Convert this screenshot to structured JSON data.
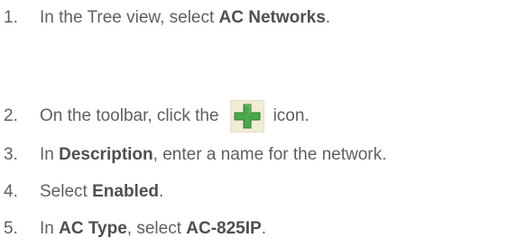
{
  "steps": [
    {
      "number": "1.",
      "pre": "In the Tree view, select ",
      "bold": "AC Networks",
      "post": "."
    },
    {
      "number": "2.",
      "pre": "On the toolbar, click the",
      "icon": "green-plus-icon",
      "post": "icon."
    },
    {
      "number": "3.",
      "pre": "In ",
      "bold": "Description",
      "post": ", enter a name for the network."
    },
    {
      "number": "4.",
      "pre": "Select ",
      "bold": "Enabled",
      "post": "."
    },
    {
      "number": "5.",
      "pre": "In ",
      "bold": "AC Type",
      "mid": ", select ",
      "bold2": "AC-825IP",
      "post": "."
    }
  ],
  "colors": {
    "text": "#5f5f5f",
    "icon_green": "#4aa84a",
    "icon_bg": "#f1ecd6"
  }
}
